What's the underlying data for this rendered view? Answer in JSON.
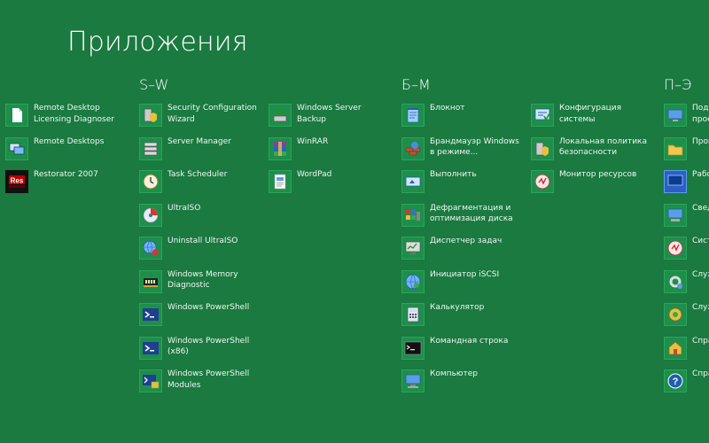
{
  "page": {
    "title": "Приложения"
  },
  "groups": [
    {
      "header": "S–W"
    },
    {
      "header": "Б–М"
    },
    {
      "header": "П–Э"
    }
  ],
  "columns": [
    [
      {
        "label": "Remote Desktop\nLicensing Diagnoser",
        "icon": "document-icon"
      },
      {
        "label": "Remote Desktops",
        "icon": "remote-desktops-icon"
      },
      {
        "label": "Restorator 2007",
        "icon": "restorator-icon"
      }
    ],
    [
      {
        "label": "Security Configuration\nWizard",
        "icon": "security-wizard-icon"
      },
      {
        "label": "Server Manager",
        "icon": "server-manager-icon"
      },
      {
        "label": "Task Scheduler",
        "icon": "clock-icon"
      },
      {
        "label": "UltraISO",
        "icon": "disc-icon"
      },
      {
        "label": "Uninstall UltraISO",
        "icon": "uninstall-icon"
      },
      {
        "label": "Windows Memory\nDiagnostic",
        "icon": "memory-chip-icon"
      },
      {
        "label": "Windows PowerShell",
        "icon": "powershell-icon"
      },
      {
        "label": "Windows PowerShell\n(x86)",
        "icon": "powershell-icon"
      },
      {
        "label": "Windows PowerShell\nModules",
        "icon": "powershell-modules-icon"
      }
    ],
    [
      {
        "label": "Windows Server\nBackup",
        "icon": "backup-icon"
      },
      {
        "label": "WinRAR",
        "icon": "winrar-icon"
      },
      {
        "label": "WordPad",
        "icon": "wordpad-icon"
      }
    ],
    [
      {
        "label": "Блокнот",
        "icon": "notepad-icon"
      },
      {
        "label": "Брандмауэр Windows\nв режиме...",
        "icon": "firewall-icon"
      },
      {
        "label": "Выполнить",
        "icon": "run-icon"
      },
      {
        "label": "Дефрагментация и\nоптимизация диска",
        "icon": "defrag-icon"
      },
      {
        "label": "Диспетчер задач",
        "icon": "task-manager-icon"
      },
      {
        "label": "Инициатор iSCSI",
        "icon": "globe-icon"
      },
      {
        "label": "Калькулятор",
        "icon": "calculator-icon"
      },
      {
        "label": "Командная строка",
        "icon": "command-prompt-icon"
      },
      {
        "label": "Компьютер",
        "icon": "computer-icon"
      }
    ],
    [
      {
        "label": "Конфигурация\nсистемы",
        "icon": "system-config-icon"
      },
      {
        "label": "Локальная политика\nбезопасности",
        "icon": "security-policy-icon"
      },
      {
        "label": "Монитор ресурсов",
        "icon": "resource-monitor-icon"
      }
    ],
    [
      {
        "label": "Подк\nпрое",
        "icon": "projector-icon"
      },
      {
        "label": "Пров",
        "icon": "explorer-icon"
      },
      {
        "label": "Рабо",
        "icon": "desktop-icon"
      },
      {
        "label": "Свед",
        "icon": "system-info-icon"
      },
      {
        "label": "Сист",
        "icon": "system-monitor-icon"
      },
      {
        "label": "Служ",
        "icon": "services-icon"
      },
      {
        "label": "Служ",
        "icon": "component-services-icon"
      },
      {
        "label": "Спра",
        "icon": "help-topics-icon"
      },
      {
        "label": "Спра",
        "icon": "help-icon"
      }
    ]
  ]
}
